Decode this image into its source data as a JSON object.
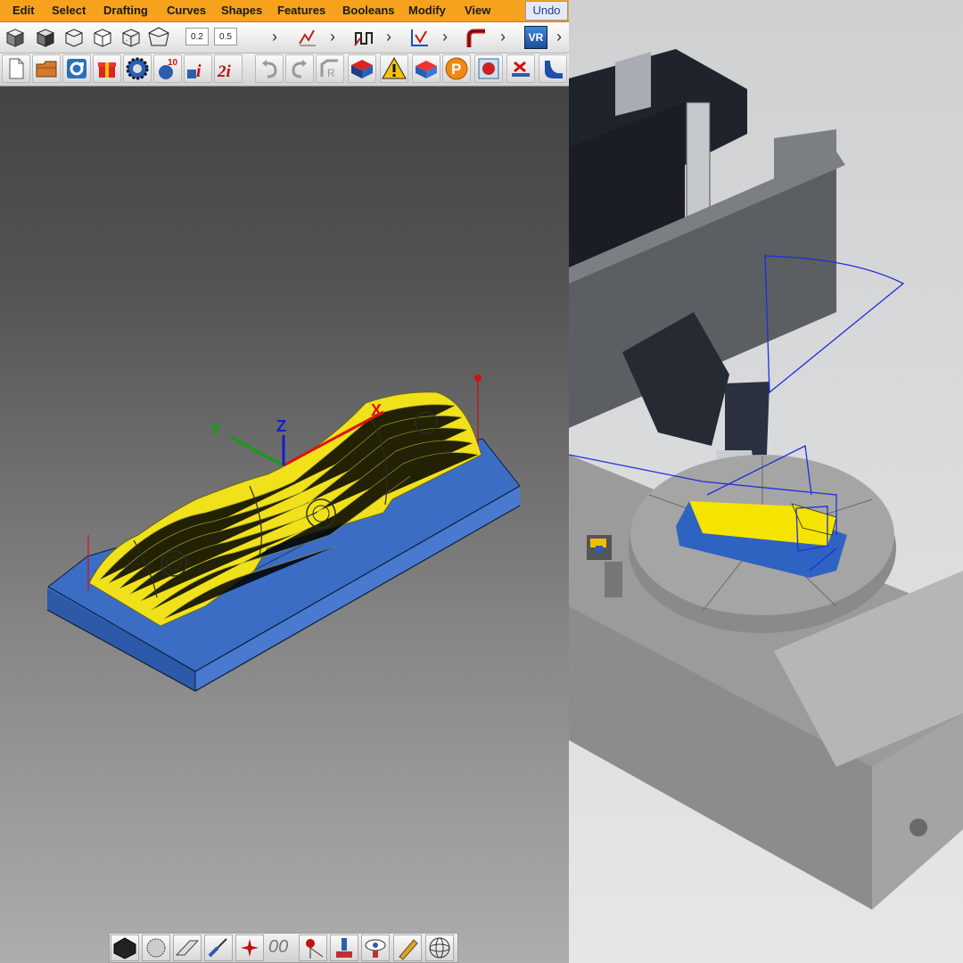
{
  "menubar": {
    "items": [
      "Edit",
      "Select",
      "Drafting",
      "Curves",
      "Shapes",
      "Features",
      "Booleans",
      "Modify",
      "View"
    ],
    "undo_label": "Undo"
  },
  "toolbar_top": {
    "tolerance_1": "0.2",
    "tolerance_2": "0.5",
    "vr_label": "VR",
    "icons": [
      "shaded-cube-icon",
      "shaded-cube-icon",
      "wireframe-cube-icon",
      "wireframe-cube-icon",
      "wireframe-cube-icon",
      "wireframe-polyhedron-icon",
      "tolerance-icon",
      "tolerance-icon",
      "expand-chevron-icon",
      "toolpath-icon",
      "expand-chevron-icon",
      "zigzag-toolpath-icon",
      "expand-chevron-icon",
      "5axis-toolpath-icon",
      "expand-chevron-icon",
      "bend-curve-icon",
      "expand-chevron-icon",
      "vr-icon",
      "expand-chevron-icon"
    ]
  },
  "toolbar_main": {
    "label_10": "10",
    "label_i": "i",
    "label_2i": "2i",
    "label_p": "P",
    "icons": [
      "new-document-icon",
      "open-folder-icon",
      "rotate-view-icon",
      "gift-box-icon",
      "settings-gear-icon",
      "counter-icon",
      "info-icon",
      "info-2-icon",
      "undo-arrow-icon",
      "redo-arrow-icon",
      "ruler-icon",
      "stock-box-icon",
      "warning-icon",
      "simulate-icon",
      "postprocess-icon",
      "sphere-in-cube-icon",
      "delete-toolpath-icon",
      "surface-icon"
    ]
  },
  "axes": {
    "x_label": "X",
    "y_label": "Y",
    "z_label": "Z"
  },
  "bottom_toolbar": {
    "label_00": "00",
    "icons": [
      "shaded-mode-icon",
      "texture-sphere-icon",
      "plane-icon",
      "brush-icon",
      "star-sparkle-icon",
      "zero-icon",
      "pin-marker-icon",
      "tool-holder-icon",
      "visibility-eye-icon",
      "pencil-icon",
      "wireframe-sphere-icon"
    ]
  },
  "colors": {
    "menu_orange": "#f7a21c",
    "stock_blue": "#3f6fc0",
    "toolpath_yellow": "#f4e200",
    "axis_x": "#e01010",
    "axis_y": "#10a010",
    "axis_z": "#1020d0",
    "machine_gray": "#9a9a9a"
  }
}
